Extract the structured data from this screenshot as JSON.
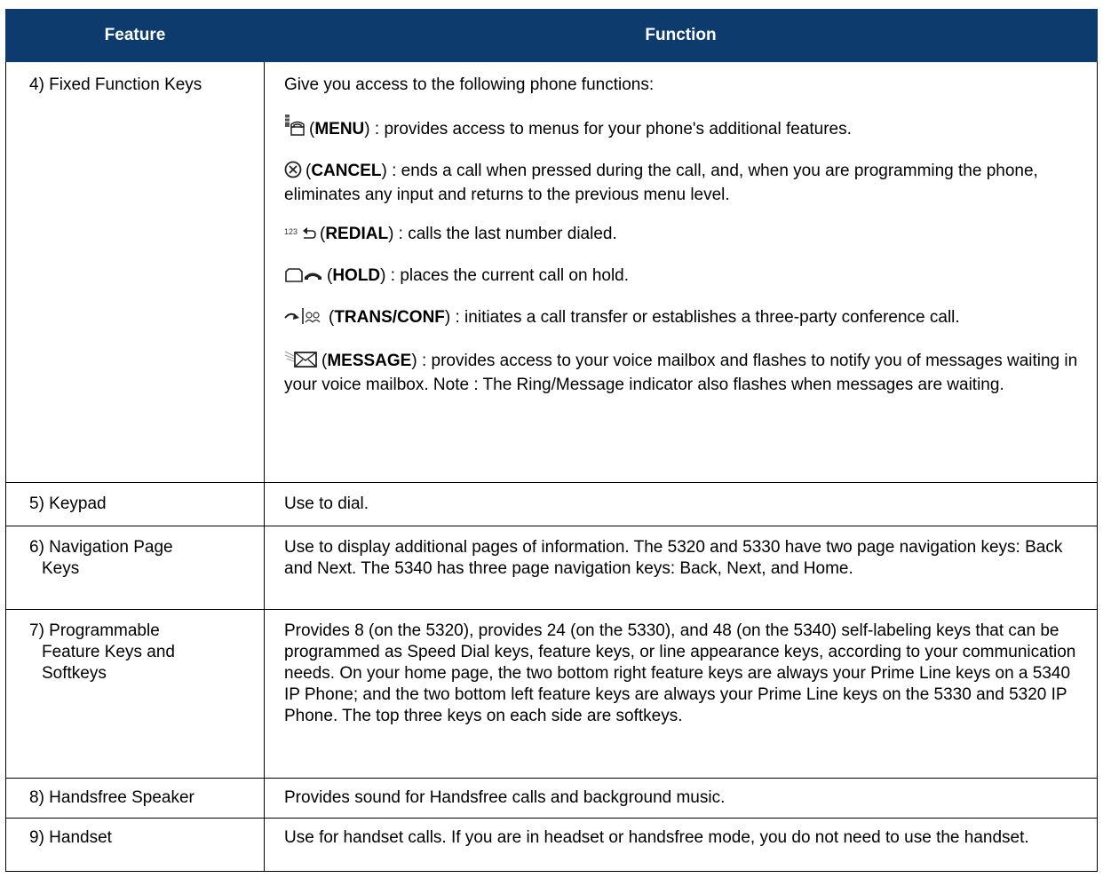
{
  "header": {
    "feature": "Feature",
    "function": "Function"
  },
  "rows": {
    "r4": {
      "feature": "4) Fixed Function Keys",
      "intro": "Give you access to the following phone functions:",
      "menu": {
        "icon": "menu-icon",
        "name": "MENU",
        "desc": ": provides access to menus for your phone's additional features."
      },
      "cancel": {
        "icon": "cancel-icon",
        "name": "CANCEL",
        "desc": ": ends a call when pressed during the call, and, when you are programming the phone, eliminates any input and returns to the previous menu level."
      },
      "redial": {
        "icon": "redial-icon",
        "name": "REDIAL",
        "desc": ": calls the last number dialed."
      },
      "hold": {
        "icon": "hold-icon",
        "name": "HOLD",
        "desc": ": places the current call on hold."
      },
      "transconf": {
        "icon": "trans-conf-icon",
        "name_a": "TRANS",
        "sep": "/",
        "name_b": "CONF",
        "desc": ": initiates a call transfer or establishes a three-party conference call."
      },
      "message": {
        "icon": "message-icon",
        "name": "MESSAGE",
        "desc": ": provides access to your voice mailbox and flashes to notify you of messages waiting in your voice mailbox. Note : The Ring/Message indicator also flashes when messages are waiting."
      }
    },
    "r5": {
      "feature": "5) Keypad",
      "function": "Use to dial."
    },
    "r6": {
      "feature_1": "6) Navigation Page",
      "feature_2": "Keys",
      "function": "Use to display additional pages of information. The 5320 and 5330 have two page navigation keys: Back and Next. The 5340 has three page navigation keys: Back, Next, and Home."
    },
    "r7": {
      "feature_1": "7) Programmable",
      "feature_2": "Feature Keys and",
      "feature_3": "Softkeys",
      "function": "Provides 8 (on the 5320), provides 24 (on the 5330), and 48 (on the 5340) self-labeling keys that can be programmed as Speed Dial keys, feature keys, or line appearance keys, according to your communication needs. On your home page, the two bottom right feature keys are always your Prime Line keys on a 5340 IP Phone; and the two bottom left feature keys are always your Prime Line keys on the 5330 and 5320 IP Phone. The top three keys on each side are softkeys."
    },
    "r8": {
      "feature": "8) Handsfree Speaker",
      "function": "Provides sound for Handsfree calls and background music."
    },
    "r9": {
      "feature": "9) Handset",
      "function": "Use for handset calls. If you are in headset or handsfree mode, you do not need to use the handset."
    }
  },
  "colors": {
    "header_bg": "#0d3b6e",
    "header_text": "#ffffff",
    "border": "#000000"
  }
}
